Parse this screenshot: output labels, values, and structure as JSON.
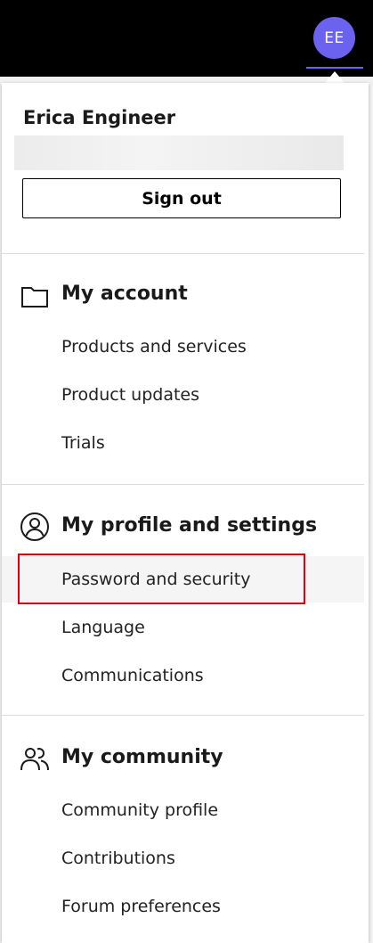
{
  "header": {
    "avatar_initials": "EE",
    "avatar_color": "#6b63f0"
  },
  "profile": {
    "name": "Erica Engineer",
    "sign_out_label": "Sign out"
  },
  "sections": [
    {
      "icon": "folder-icon",
      "title": "My account",
      "items": [
        {
          "label": "Products and services"
        },
        {
          "label": "Product updates"
        },
        {
          "label": "Trials"
        }
      ]
    },
    {
      "icon": "user-circle-icon",
      "title": "My profile and settings",
      "items": [
        {
          "label": "Password and security",
          "highlighted": true
        },
        {
          "label": "Language"
        },
        {
          "label": "Communications"
        }
      ]
    },
    {
      "icon": "people-icon",
      "title": "My community",
      "items": [
        {
          "label": "Community profile"
        },
        {
          "label": "Contributions"
        },
        {
          "label": "Forum preferences"
        }
      ]
    }
  ],
  "colors": {
    "highlight_border": "#e00012",
    "topbar": "#000000"
  }
}
